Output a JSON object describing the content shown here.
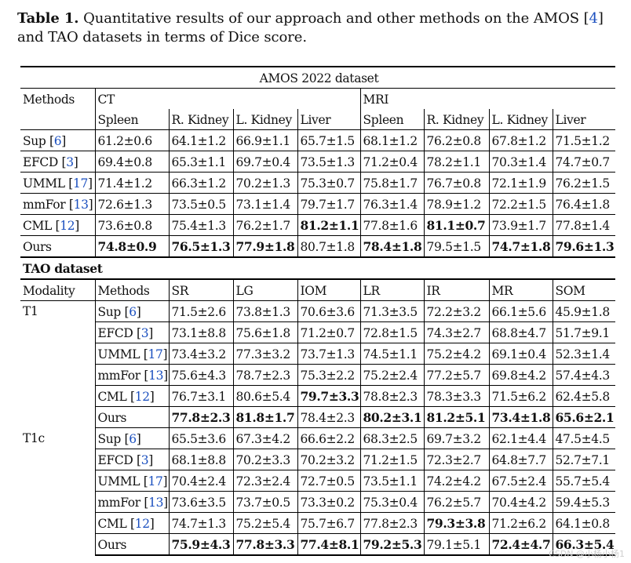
{
  "caption": {
    "label": "Table 1.",
    "text_before_ref": " Quantitative results of our approach and other methods on the AMOS [",
    "ref": "4",
    "text_after_ref": "] and TAO datasets in terms of Dice score."
  },
  "amos": {
    "title": "AMOS 2022 dataset",
    "methods_header": "Methods",
    "ct_label": "CT",
    "mri_label": "MRI",
    "columns": [
      "Spleen",
      "R. Kidney",
      "L. Kidney",
      "Liver",
      "Spleen",
      "R. Kidney",
      "L. Kidney",
      "Liver"
    ],
    "rows": [
      {
        "method": "Sup [",
        "ref": "6",
        "close": "]",
        "values": [
          "61.2±0.6",
          "64.1±1.2",
          "66.9±1.1",
          "65.7±1.5",
          "68.1±1.2",
          "76.2±0.8",
          "67.8±1.2",
          "71.5±1.2"
        ],
        "bold": []
      },
      {
        "method": "EFCD [",
        "ref": "3",
        "close": "]",
        "values": [
          "69.4±0.8",
          "65.3±1.1",
          "69.7±0.4",
          "73.5±1.3",
          "71.2±0.4",
          "78.2±1.1",
          "70.3±1.4",
          "74.7±0.7"
        ],
        "bold": []
      },
      {
        "method": "UMML [",
        "ref": "17",
        "close": "]",
        "values": [
          "71.4±1.2",
          "66.3±1.2",
          "70.2±1.3",
          "75.3±0.7",
          "75.8±1.7",
          "76.7±0.8",
          "72.1±1.9",
          "76.2±1.5"
        ],
        "bold": []
      },
      {
        "method": "mmFor [",
        "ref": "13",
        "close": "]",
        "values": [
          "72.6±1.3",
          "73.5±0.5",
          "73.1±1.4",
          "79.7±1.7",
          "76.3±1.4",
          "78.9±1.2",
          "72.2±1.5",
          "76.4±1.8"
        ],
        "bold": []
      },
      {
        "method": "CML [",
        "ref": "12",
        "close": "]",
        "values": [
          "73.6±0.8",
          "75.4±1.3",
          "76.2±1.7",
          "81.2±1.1",
          "77.8±1.6",
          "81.1±0.7",
          "73.9±1.7",
          "77.8±1.4"
        ],
        "bold": [
          3,
          5
        ]
      },
      {
        "method": "Ours",
        "ref": "",
        "close": "",
        "values": [
          "74.8±0.9",
          "76.5±1.3",
          "77.9±1.8",
          "80.7±1.8",
          "78.4±1.8",
          "79.5±1.5",
          "74.7±1.8",
          "79.6±1.3"
        ],
        "bold": [
          0,
          1,
          2,
          4,
          6,
          7
        ]
      }
    ]
  },
  "tao": {
    "title": "TAO dataset",
    "modality_header": "Modality",
    "methods_header": "Methods",
    "columns": [
      "SR",
      "LG",
      "IOM",
      "LR",
      "IR",
      "MR",
      "SOM"
    ],
    "groups": [
      {
        "modality": "T1",
        "rows": [
          {
            "method": "Sup [",
            "ref": "6",
            "close": "]",
            "values": [
              "71.5±2.6",
              "73.8±1.3",
              "70.6±3.6",
              "71.3±3.5",
              "72.2±3.2",
              "66.1±5.6",
              "45.9±1.8"
            ],
            "bold": []
          },
          {
            "method": "EFCD [",
            "ref": "3",
            "close": "]",
            "values": [
              "73.1±8.8",
              "75.6±1.8",
              "71.2±0.7",
              "72.8±1.5",
              "74.3±2.7",
              "68.8±4.7",
              "51.7±9.1"
            ],
            "bold": []
          },
          {
            "method": "UMML [",
            "ref": "17",
            "close": "]",
            "values": [
              "73.4±3.2",
              "77.3±3.2",
              "73.7±1.3",
              "74.5±1.1",
              "75.2±4.2",
              "69.1±0.4",
              "52.3±1.4"
            ],
            "bold": []
          },
          {
            "method": "mmFor [",
            "ref": "13",
            "close": "]",
            "values": [
              "75.6±4.3",
              "78.7±2.3",
              "75.3±2.2",
              "75.2±2.4",
              "77.2±5.7",
              "69.8±4.2",
              "57.4±4.3"
            ],
            "bold": []
          },
          {
            "method": "CML [",
            "ref": "12",
            "close": "]",
            "values": [
              "76.7±3.1",
              "80.6±5.4",
              "79.7±3.3",
              "78.8±2.3",
              "78.3±3.3",
              "71.5±6.2",
              "62.4±5.8"
            ],
            "bold": [
              2
            ]
          },
          {
            "method": "Ours",
            "ref": "",
            "close": "",
            "values": [
              "77.8±2.3",
              "81.8±1.7",
              "78.4±2.3",
              "80.2±3.1",
              "81.2±5.1",
              "73.4±1.8",
              "65.6±2.1"
            ],
            "bold": [
              0,
              1,
              3,
              4,
              5,
              6
            ]
          }
        ]
      },
      {
        "modality": "T1c",
        "rows": [
          {
            "method": "Sup [",
            "ref": "6",
            "close": "]",
            "values": [
              "65.5±3.6",
              "67.3±4.2",
              "66.6±2.2",
              "68.3±2.5",
              "69.7±3.2",
              "62.1±4.4",
              "47.5±4.5"
            ],
            "bold": []
          },
          {
            "method": "EFCD [",
            "ref": "3",
            "close": "]",
            "values": [
              "68.1±8.8",
              "70.2±3.3",
              "70.2±3.2",
              "71.2±1.5",
              "72.3±2.7",
              "64.8±7.7",
              "52.7±7.1"
            ],
            "bold": []
          },
          {
            "method": "UMML [",
            "ref": "17",
            "close": "]",
            "values": [
              "70.4±2.4",
              "72.3±2.4",
              "72.7±0.5",
              "73.5±1.1",
              "74.2±4.2",
              "67.5±2.4",
              "55.7±5.4"
            ],
            "bold": []
          },
          {
            "method": "mmFor [",
            "ref": "13",
            "close": "]",
            "values": [
              "73.6±3.5",
              "73.7±0.5",
              "73.3±0.2",
              "75.3±0.4",
              "76.2±5.7",
              "70.4±4.2",
              "59.4±5.3"
            ],
            "bold": []
          },
          {
            "method": "CML [",
            "ref": "12",
            "close": "]",
            "values": [
              "74.7±1.3",
              "75.2±5.4",
              "75.7±6.7",
              "77.8±2.3",
              "79.3±3.8",
              "71.2±6.2",
              "64.1±0.8"
            ],
            "bold": [
              4
            ]
          },
          {
            "method": "Ours",
            "ref": "",
            "close": "",
            "values": [
              "75.9±4.3",
              "77.8±3.3",
              "77.4±8.1",
              "79.2±5.3",
              "79.1±5.1",
              "72.4±4.7",
              "66.3±5.4"
            ],
            "bold": [
              0,
              1,
              2,
              3,
              5,
              6
            ]
          }
        ]
      }
    ]
  },
  "watermark": "CSDN @小杨小杨1"
}
